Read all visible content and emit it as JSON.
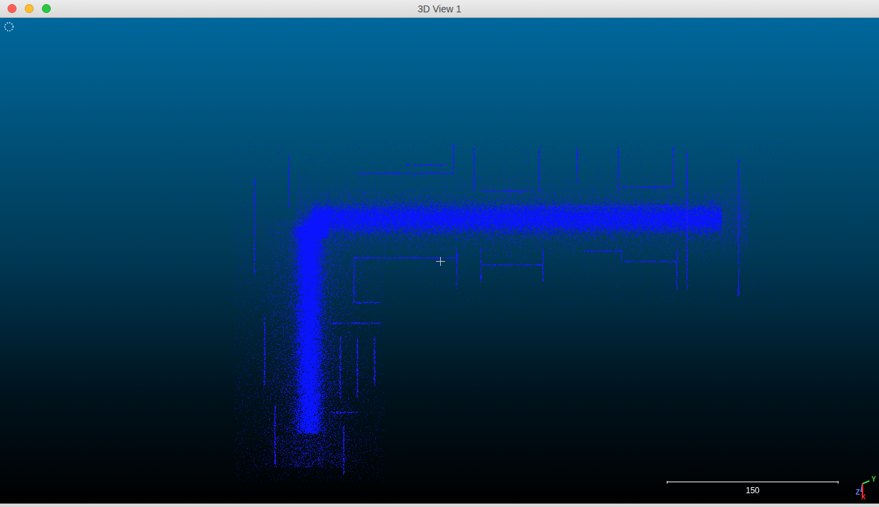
{
  "window": {
    "title": "3D View 1"
  },
  "window_controls": [
    {
      "color": "#fe5f57"
    },
    {
      "color": "#febc2e"
    },
    {
      "color": "#28c840"
    }
  ],
  "scale_bar": {
    "label": "150"
  },
  "axes": [
    {
      "label": "Y",
      "color": "#3cdc3c"
    },
    {
      "label": "Z",
      "color": "#6a82ff"
    },
    {
      "label": "X",
      "color": "#ff2a2a"
    }
  ]
}
